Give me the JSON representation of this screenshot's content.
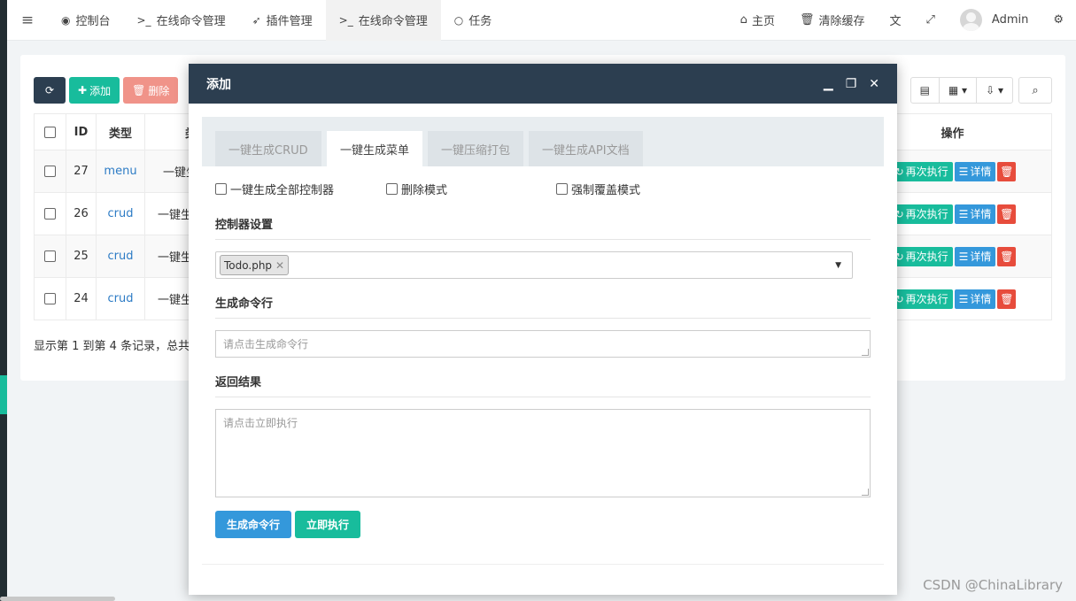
{
  "nav": {
    "tabs": [
      {
        "icon": "◉",
        "label": "控制台"
      },
      {
        "icon": ">_",
        "label": "在线命令管理"
      },
      {
        "icon": "➶",
        "label": "插件管理"
      },
      {
        "icon": ">_",
        "label": "在线命令管理"
      },
      {
        "icon": "○",
        "label": "任务"
      }
    ],
    "home_label": "主页",
    "clear_cache_label": "清除缓存",
    "user_name": "Admin"
  },
  "toolbar": {
    "add_label": "添加",
    "delete_label": "删除"
  },
  "table": {
    "headers": [
      "ID",
      "类型",
      "类",
      "操作"
    ],
    "rows": [
      {
        "id": "27",
        "type": "menu",
        "content": "一键生"
      },
      {
        "id": "26",
        "type": "crud",
        "content": "一键生"
      },
      {
        "id": "25",
        "type": "crud",
        "content": "一键生"
      },
      {
        "id": "24",
        "type": "crud",
        "content": "一键生"
      }
    ],
    "rerun_label": "再次执行",
    "detail_label": "详情",
    "pager_text": "显示第 1 到第 4 条记录，总共"
  },
  "modal": {
    "title": "添加",
    "tabs": [
      "一键生成CRUD",
      "一键生成菜单",
      "一键压缩打包",
      "一键生成API文档"
    ],
    "active_tab": 1,
    "options": [
      "一键生成全部控制器",
      "删除模式",
      "强制覆盖模式"
    ],
    "controller_section": "控制器设置",
    "selected_controller": "Todo.php",
    "command_section": "生成命令行",
    "command_placeholder": "请点击生成命令行",
    "result_section": "返回结果",
    "result_placeholder": "请点击立即执行",
    "generate_button": "生成命令行",
    "execute_button": "立即执行"
  },
  "watermark": "CSDN @ChinaLibrary",
  "colors": {
    "primary_dark": "#2c3e50",
    "success": "#18bc9c",
    "info": "#3498db",
    "danger": "#e74c3c"
  }
}
